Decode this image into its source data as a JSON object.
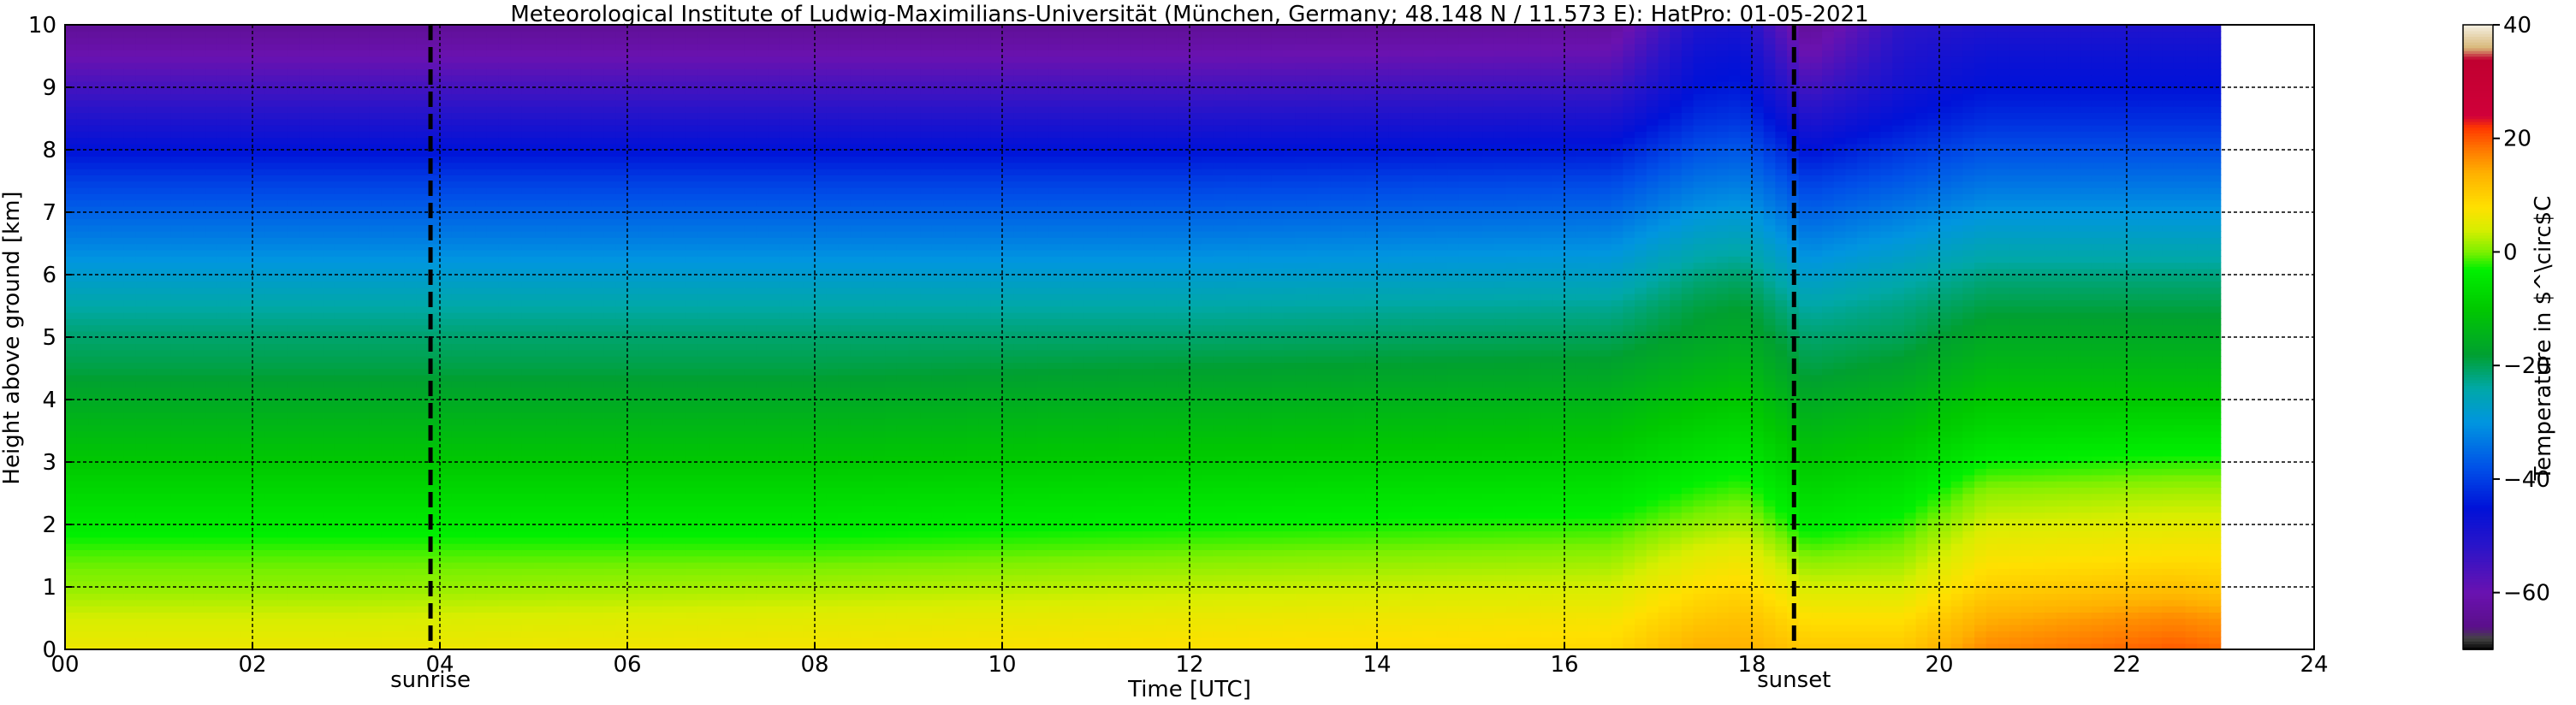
{
  "chart_data": [
    {
      "type": "heatmap",
      "title": "Meteorological Institute of Ludwig-Maximilians-Universität (München, Germany; 48.148 N / 11.573 E):    HatPro: 01-05-2021",
      "xlabel": "Time [UTC]",
      "ylabel": "Height above ground [km]",
      "xlim": [
        0,
        24
      ],
      "ylim": [
        0,
        10
      ],
      "x_tick_labels": [
        "00",
        "02",
        "04",
        "06",
        "08",
        "10",
        "12",
        "14",
        "16",
        "18",
        "20",
        "22",
        "24"
      ],
      "y_tick_labels": [
        "0",
        "1",
        "2",
        "3",
        "4",
        "5",
        "6",
        "7",
        "8",
        "9",
        "10"
      ],
      "grid": true,
      "data_x_range": [
        0,
        23
      ],
      "height_km": [
        0,
        0.5,
        1,
        1.5,
        2,
        2.5,
        3,
        3.5,
        4,
        4.5,
        5,
        5.5,
        6,
        6.5,
        7,
        7.5,
        8,
        8.5,
        9,
        9.5,
        10
      ],
      "profiles_temperature_c": [
        {
          "time_utc": 0,
          "values": [
            6,
            4,
            1,
            -1,
            -4,
            -7,
            -10,
            -13,
            -16,
            -19,
            -21,
            -24,
            -28,
            -32,
            -36,
            -40,
            -45,
            -50,
            -55,
            -60,
            -64
          ]
        },
        {
          "time_utc": 3,
          "values": [
            6,
            4,
            1,
            -1,
            -4,
            -7,
            -10,
            -13,
            -16,
            -19,
            -21,
            -24,
            -28,
            -32,
            -36,
            -40,
            -45,
            -50,
            -55,
            -60,
            -64
          ]
        },
        {
          "time_utc": 8,
          "values": [
            7,
            5,
            2,
            -1,
            -4,
            -7,
            -10,
            -13,
            -16,
            -19,
            -21,
            -24,
            -28,
            -32,
            -36,
            -40,
            -45,
            -50,
            -55,
            -60,
            -64
          ]
        },
        {
          "time_utc": 12,
          "values": [
            8,
            6,
            3,
            0,
            -3,
            -6,
            -9,
            -12,
            -15,
            -18,
            -21,
            -24,
            -28,
            -32,
            -36,
            -40,
            -45,
            -50,
            -55,
            -60,
            -64
          ]
        },
        {
          "time_utc": 16.5,
          "values": [
            9,
            7,
            4,
            1,
            -2,
            -5,
            -8,
            -11,
            -14,
            -17,
            -20,
            -23,
            -27,
            -31,
            -35,
            -39,
            -44,
            -49,
            -54,
            -59,
            -63
          ]
        },
        {
          "time_utc": 17.4,
          "values": [
            14,
            11,
            8,
            5,
            1,
            -2,
            -5,
            -8,
            -11,
            -14,
            -17,
            -19,
            -22,
            -26,
            -30,
            -34,
            -38,
            -42,
            -45,
            -47,
            -50
          ]
        },
        {
          "time_utc": 17.9,
          "values": [
            14,
            12,
            9,
            6,
            2,
            -1,
            -4,
            -7,
            -10,
            -13,
            -16,
            -18,
            -21,
            -25,
            -29,
            -33,
            -37,
            -41,
            -44,
            -46,
            -49
          ]
        },
        {
          "time_utc": 18.6,
          "values": [
            11,
            8,
            4,
            0,
            -4,
            -7,
            -10,
            -13,
            -16,
            -19,
            -21,
            -24,
            -28,
            -32,
            -36,
            -40,
            -45,
            -50,
            -55,
            -60,
            -64
          ]
        },
        {
          "time_utc": 19.6,
          "values": [
            11,
            8,
            4,
            1,
            -2,
            -5,
            -8,
            -11,
            -14,
            -17,
            -20,
            -22,
            -25,
            -29,
            -33,
            -37,
            -41,
            -45,
            -48,
            -50,
            -52
          ]
        },
        {
          "time_utc": 20.5,
          "values": [
            17,
            14,
            10,
            7,
            4,
            1,
            -3,
            -7,
            -10,
            -13,
            -16,
            -19,
            -22,
            -26,
            -30,
            -34,
            -38,
            -42,
            -45,
            -47,
            -50
          ]
        },
        {
          "time_utc": 22.5,
          "values": [
            20,
            17,
            12,
            8,
            5,
            2,
            -2,
            -6,
            -10,
            -13,
            -16,
            -19,
            -22,
            -26,
            -30,
            -34,
            -38,
            -42,
            -45,
            -47,
            -50
          ]
        },
        {
          "time_utc": 23,
          "values": [
            19,
            16,
            11,
            8,
            5,
            2,
            -2,
            -6,
            -10,
            -13,
            -16,
            -19,
            -22,
            -26,
            -30,
            -34,
            -38,
            -42,
            -45,
            -47,
            -50
          ]
        }
      ],
      "event_lines": [
        {
          "time_utc": 3.9,
          "label": "sunrise"
        },
        {
          "time_utc": 18.45,
          "label": "sunset"
        }
      ],
      "colorbar": {
        "label": "Temperature in $^\\circ$C",
        "range": [
          -70,
          40
        ],
        "ticks": [
          "40",
          "20",
          "0",
          "−20",
          "−40",
          "−60"
        ],
        "tick_values": [
          40,
          20,
          0,
          -20,
          -40,
          -60
        ],
        "stops": [
          {
            "value": -70,
            "color": "#000000"
          },
          {
            "value": -68,
            "color": "#444444"
          },
          {
            "value": -66,
            "color": "#5a0f8a"
          },
          {
            "value": -60,
            "color": "#6a12b0"
          },
          {
            "value": -52,
            "color": "#2c14c8"
          },
          {
            "value": -45,
            "color": "#0012d8"
          },
          {
            "value": -38,
            "color": "#0050e8"
          },
          {
            "value": -30,
            "color": "#0095e0"
          },
          {
            "value": -24,
            "color": "#00a8a8"
          },
          {
            "value": -18,
            "color": "#00a030"
          },
          {
            "value": -10,
            "color": "#00c800"
          },
          {
            "value": -3,
            "color": "#00f000"
          },
          {
            "value": 0,
            "color": "#7af000"
          },
          {
            "value": 4,
            "color": "#d8ee00"
          },
          {
            "value": 8,
            "color": "#ffe000"
          },
          {
            "value": 14,
            "color": "#ffb000"
          },
          {
            "value": 18,
            "color": "#ff7a00"
          },
          {
            "value": 22,
            "color": "#ff3800"
          },
          {
            "value": 24,
            "color": "#d0003a"
          },
          {
            "value": 34,
            "color": "#c00030"
          },
          {
            "value": 36,
            "color": "#d8b878"
          },
          {
            "value": 40,
            "color": "#f4efe0"
          }
        ]
      }
    }
  ]
}
